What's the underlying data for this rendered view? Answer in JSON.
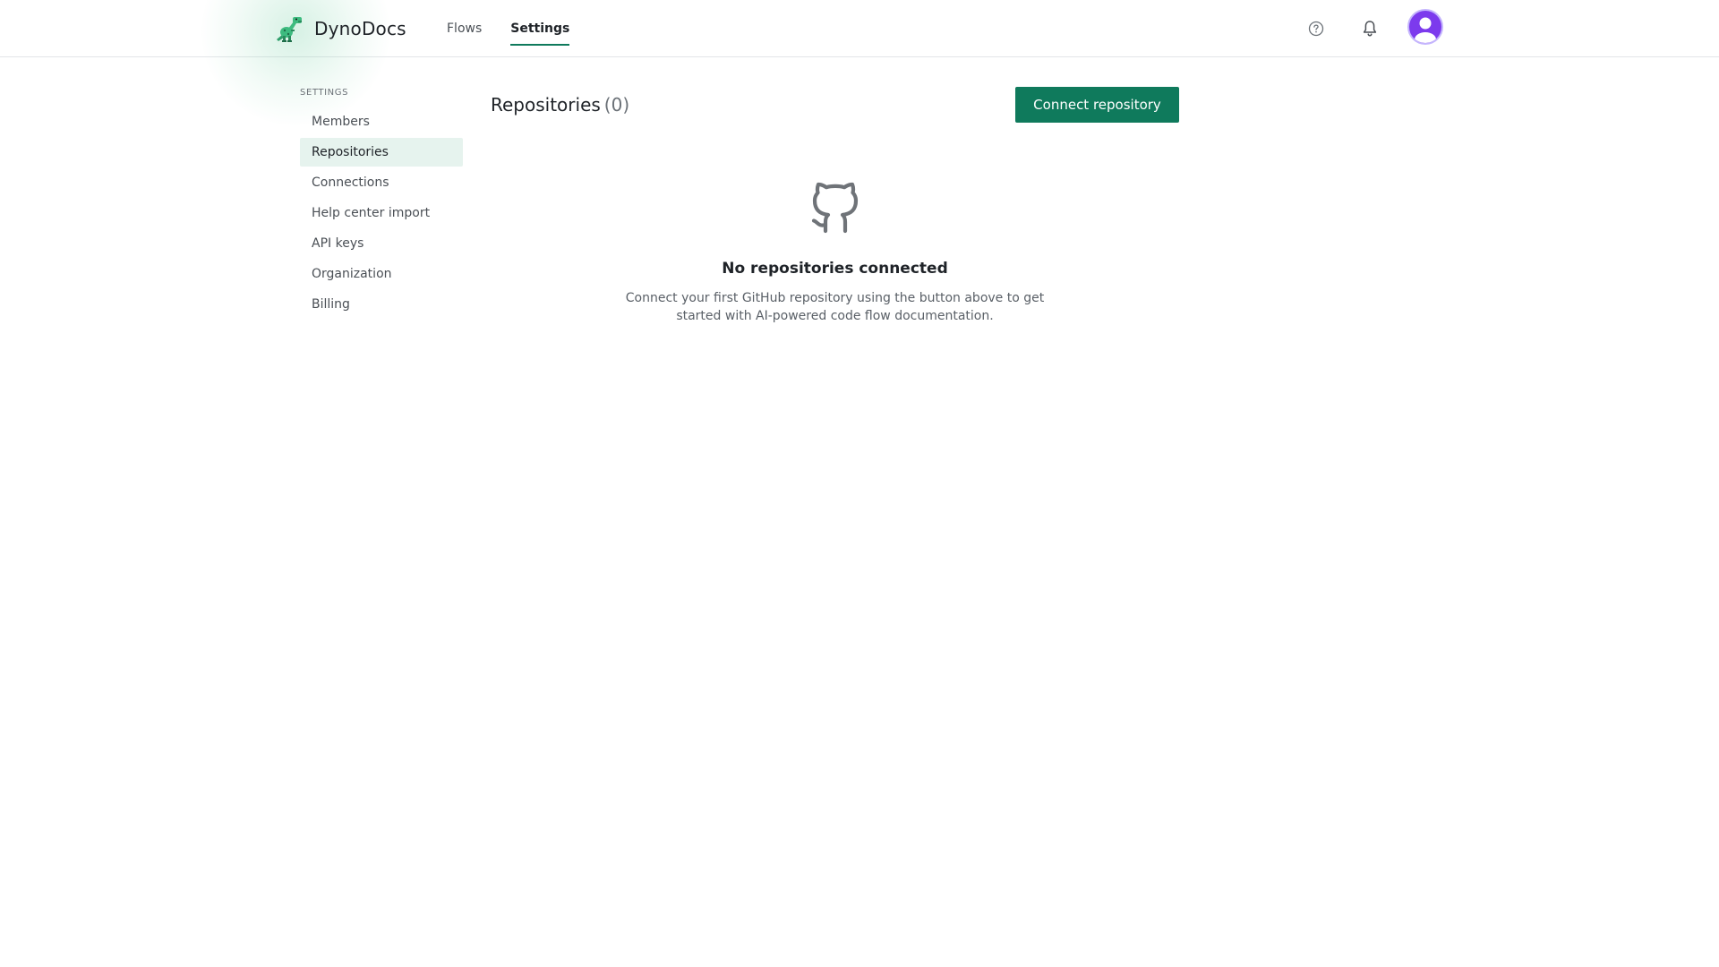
{
  "header": {
    "brand_name": "DynoDocs",
    "nav": [
      {
        "label": "Flows",
        "active": false
      },
      {
        "label": "Settings",
        "active": true
      }
    ],
    "icons": [
      "dinosaur-logo-icon",
      "help-circle-icon",
      "bell-icon",
      "user-avatar-icon"
    ]
  },
  "sidebar": {
    "heading": "SETTINGS",
    "items": [
      {
        "label": "Members",
        "active": false
      },
      {
        "label": "Repositories",
        "active": true
      },
      {
        "label": "Connections",
        "active": false
      },
      {
        "label": "Help center import",
        "active": false
      },
      {
        "label": "API keys",
        "active": false
      },
      {
        "label": "Organization",
        "active": false
      },
      {
        "label": "Billing",
        "active": false
      }
    ]
  },
  "main": {
    "title": "Repositories",
    "count": "(0)",
    "connect_button": "Connect repository",
    "empty_state": {
      "icon": "github-icon",
      "title": "No repositories connected",
      "description": "Connect your first GitHub repository using the button above to get started with AI-powered code flow documentation."
    }
  },
  "colors": {
    "accent": "#0f7a5c",
    "sidebar_active_bg": "#e6f3ee",
    "avatar_bg": "#7c3aed",
    "border": "#e3e5e8"
  }
}
